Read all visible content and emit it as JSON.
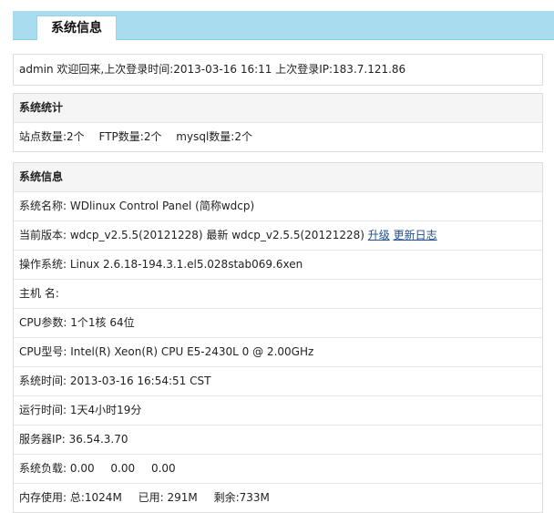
{
  "header": {
    "tab_label": "系统信息"
  },
  "welcome": {
    "text": "admin 欢迎回来,上次登录时间:2013-03-16 16:11 上次登录IP:183.7.121.86"
  },
  "stats": {
    "title": "系统统计",
    "sites": "站点数量:2个",
    "ftp": "FTP数量:2个",
    "mysql": "mysql数量:2个"
  },
  "sysinfo": {
    "title": "系统信息",
    "name": "系统名称: WDlinux Control Panel (简称wdcp)",
    "version_text": "当前版本: wdcp_v2.5.5(20121228) 最新 wdcp_v2.5.5(20121228)",
    "upgrade_link": "升级",
    "changelog_link": "更新日志",
    "os": "操作系统: Linux 2.6.18-194.3.1.el5.028stab069.6xen",
    "hostname": "主机 名:",
    "cpu_params": "CPU参数: 1个1核 64位",
    "cpu_model": "CPU型号:  Intel(R) Xeon(R) CPU E5-2430L 0 @ 2.00GHz",
    "sys_time": "系统时间: 2013-03-16 16:54:51 CST",
    "uptime": "运行时间: 1天4小时19分",
    "server_ip": "服务器IP: 36.54.3.70",
    "load_label": "系统负载:",
    "load_1": "0.00",
    "load_2": "0.00",
    "load_3": "0.00",
    "mem_label": "内存使用: ",
    "mem_total": "总:1024M",
    "mem_used": "已用: 291M",
    "mem_free": "剩余:733M"
  }
}
